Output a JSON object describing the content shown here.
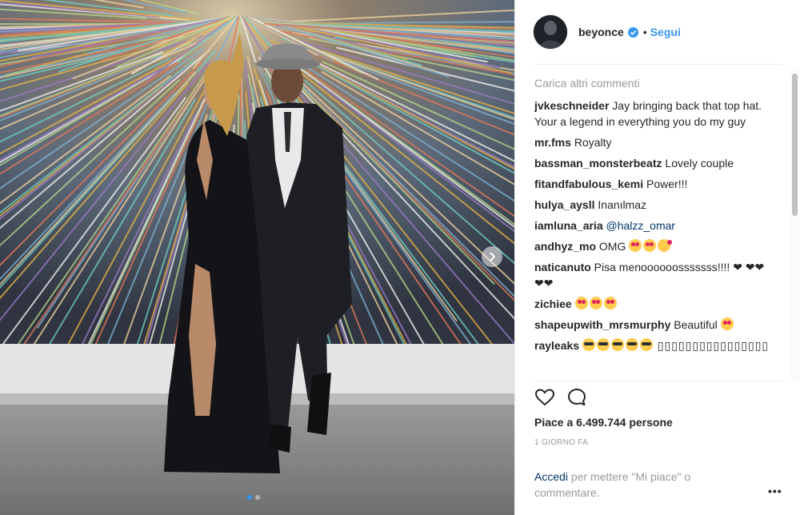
{
  "post": {
    "username": "beyonce",
    "separator": "•",
    "follow_label": "Segui",
    "load_more_label": "Carica altri commenti",
    "comments": [
      {
        "user": "jvkeschneider",
        "text": "Jay bringing back that top hat. Your a legend in everything you do my guy"
      },
      {
        "user": "mr.fms",
        "text": "Royalty"
      },
      {
        "user": "bassman_monsterbeatz",
        "text": "Lovely couple"
      },
      {
        "user": "fitandfabulous_kemi",
        "text": "Power!!!"
      },
      {
        "user": "hulya_aysll",
        "text": "Inanılmaz"
      },
      {
        "user": "iamluna_aria",
        "mention": "@halzz_omar"
      },
      {
        "user": "andhyz_mo",
        "text": "OMG"
      },
      {
        "user": "naticanuto",
        "text": "Pisa menoooooosssssss!!!! ❤ ❤❤❤❤"
      },
      {
        "user": "zichiee",
        "text": ""
      },
      {
        "user": "shapeupwith_mrsmurphy",
        "text": "Beautiful"
      },
      {
        "user": "rayleaks",
        "text": "▯▯▯▯▯▯▯▯▯▯▯▯▯▯▯▯"
      }
    ],
    "likes_text": "Piace a 6.499.744 persone",
    "time_ago": "1 GIORNO FA",
    "login_link": "Accedi",
    "login_rest": " per mettere \"Mi piace\" o commentare.",
    "more_label": "•••"
  },
  "icons": {
    "verified": "verified-badge-icon",
    "like": "heart-outline-icon",
    "comment": "speech-bubble-icon",
    "next": "chevron-right-icon",
    "more": "more-options-icon"
  },
  "colors": {
    "accent": "#3897f0",
    "link": "#003569",
    "muted": "#999999",
    "text": "#262626"
  },
  "carousel": {
    "count": 2,
    "active": 1
  }
}
